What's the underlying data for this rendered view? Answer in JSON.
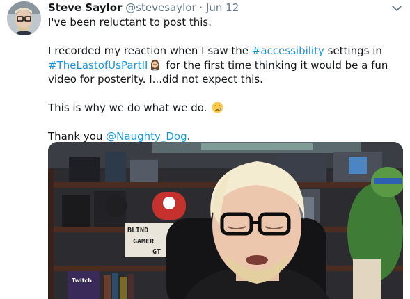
{
  "tweet": {
    "author_name": "Steve Saylor",
    "author_handle": "@stevesaylor",
    "separator": "·",
    "date": "Jun 12",
    "line1": "I've been reluctant to post this.",
    "p2_a": "I recorded my reaction when I saw the ",
    "hashtag1": "#accessibility",
    "p2_b": " settings in",
    "hashtag2": "#TheLastofUsPartII",
    "p2_c": " for the first time thinking it would be a fun",
    "p2_d": "video for posterity. I...did not expect this.",
    "p3": "This is why we do what we do.",
    "p4_a": "Thank you ",
    "mention": "@Naughty_Dog",
    "p4_b": "."
  },
  "media": {
    "sign_text": [
      "BLIND",
      "GAMER",
      "GT"
    ],
    "box_label": "Twitch"
  },
  "colors": {
    "link": "#1b95e0",
    "text": "#14171a",
    "muted": "#657786"
  },
  "icons": [
    "caret-down-icon",
    "woman-emoji-icon",
    "crying-face-emoji-icon"
  ]
}
